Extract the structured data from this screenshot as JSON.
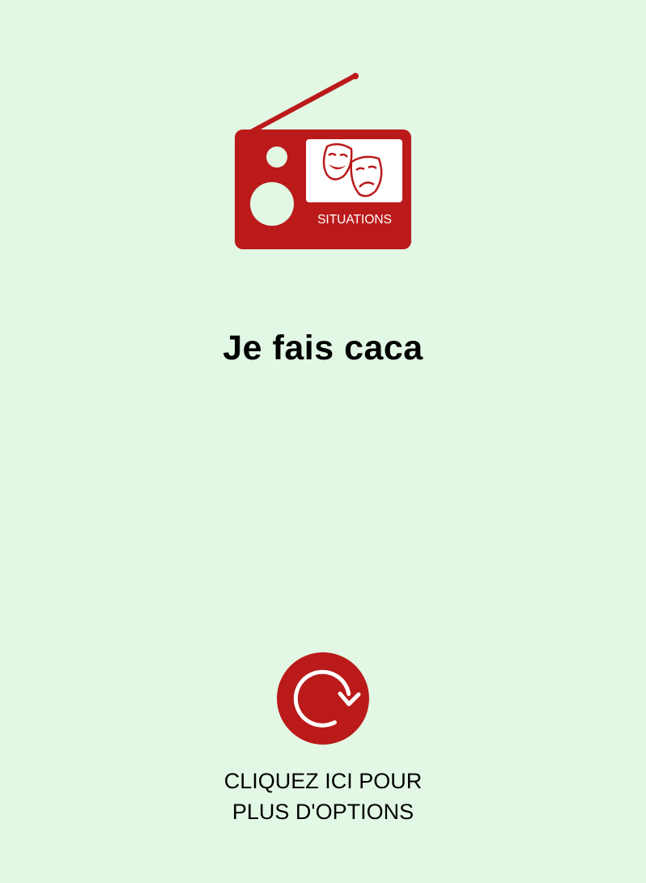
{
  "logo": {
    "label": "SITUATIONS",
    "icon": "radio-theater-masks-icon",
    "color": "#bb1a1a"
  },
  "phrase": {
    "text": "Je fais caca"
  },
  "options": {
    "icon": "refresh-icon",
    "line1": "CLIQUEZ ICI POUR",
    "line2": "PLUS D'OPTIONS"
  },
  "colors": {
    "background": "#e2f8e5",
    "accent": "#bb1a1a"
  }
}
